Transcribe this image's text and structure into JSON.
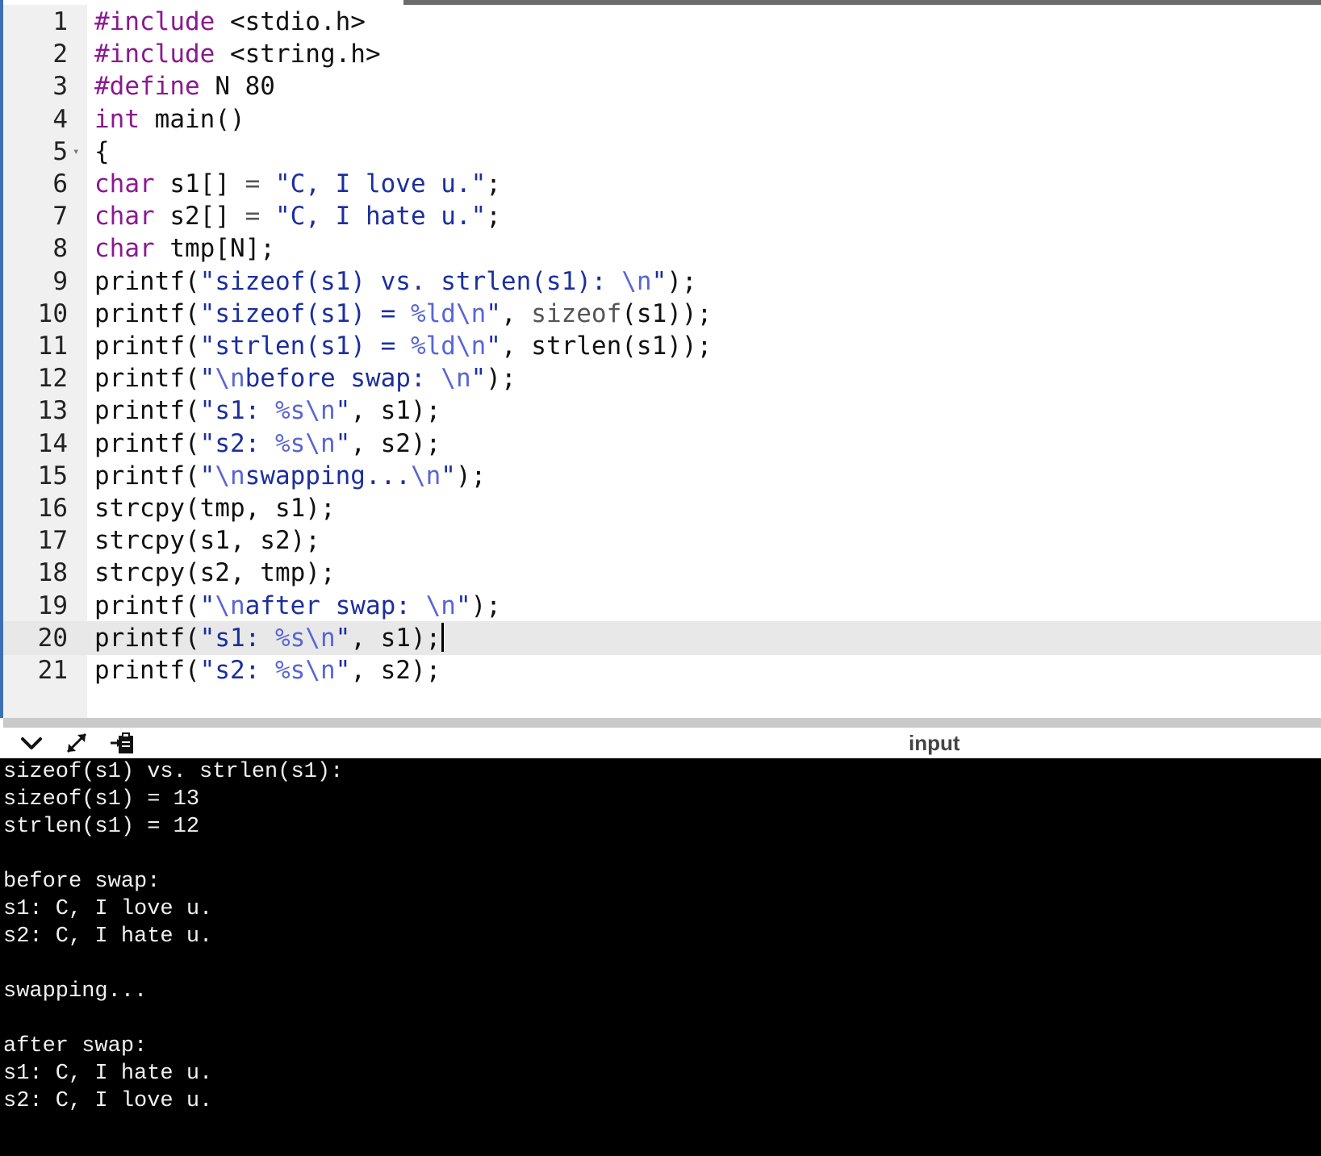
{
  "editor": {
    "active_line": 20,
    "lines": [
      {
        "n": "1",
        "tokens": [
          [
            "inc",
            "#include"
          ],
          [
            "",
            " <stdio.h>"
          ]
        ]
      },
      {
        "n": "2",
        "tokens": [
          [
            "inc",
            "#include"
          ],
          [
            "",
            " <string.h>"
          ]
        ]
      },
      {
        "n": "3",
        "tokens": [
          [
            "inc",
            "#define"
          ],
          [
            "",
            " N 80"
          ]
        ]
      },
      {
        "n": "4",
        "tokens": [
          [
            "kw",
            "int"
          ],
          [
            "",
            " main()"
          ]
        ]
      },
      {
        "n": "5",
        "fold": true,
        "tokens": [
          [
            "",
            "{"
          ]
        ]
      },
      {
        "n": "6",
        "tokens": [
          [
            "kw",
            "char"
          ],
          [
            "",
            " s1[] "
          ],
          [
            "op",
            "="
          ],
          [
            "",
            " "
          ],
          [
            "str",
            "\"C, I love u.\""
          ],
          [
            "",
            ";"
          ]
        ]
      },
      {
        "n": "7",
        "tokens": [
          [
            "kw",
            "char"
          ],
          [
            "",
            " s2[] "
          ],
          [
            "op",
            "="
          ],
          [
            "",
            " "
          ],
          [
            "str",
            "\"C, I hate u.\""
          ],
          [
            "",
            ";"
          ]
        ]
      },
      {
        "n": "8",
        "tokens": [
          [
            "kw",
            "char"
          ],
          [
            "",
            " tmp[N];"
          ]
        ]
      },
      {
        "n": "9",
        "tokens": [
          [
            "",
            "printf("
          ],
          [
            "str",
            "\"sizeof(s1) vs. strlen(s1): "
          ],
          [
            "esc",
            "\\n"
          ],
          [
            "str",
            "\""
          ],
          [
            "",
            ");"
          ]
        ]
      },
      {
        "n": "10",
        "tokens": [
          [
            "",
            "printf("
          ],
          [
            "str",
            "\"sizeof(s1) = "
          ],
          [
            "esc",
            "%ld\\n"
          ],
          [
            "str",
            "\""
          ],
          [
            "",
            ", "
          ],
          [
            "fn",
            "sizeof"
          ],
          [
            "",
            "(s1));"
          ]
        ]
      },
      {
        "n": "11",
        "tokens": [
          [
            "",
            "printf("
          ],
          [
            "str",
            "\"strlen(s1) = "
          ],
          [
            "esc",
            "%ld\\n"
          ],
          [
            "str",
            "\""
          ],
          [
            "",
            ", strlen(s1));"
          ]
        ]
      },
      {
        "n": "12",
        "tokens": [
          [
            "",
            "printf("
          ],
          [
            "str",
            "\""
          ],
          [
            "esc",
            "\\n"
          ],
          [
            "str",
            "before swap: "
          ],
          [
            "esc",
            "\\n"
          ],
          [
            "str",
            "\""
          ],
          [
            "",
            ");"
          ]
        ]
      },
      {
        "n": "13",
        "tokens": [
          [
            "",
            "printf("
          ],
          [
            "str",
            "\"s1: "
          ],
          [
            "esc",
            "%s\\n"
          ],
          [
            "str",
            "\""
          ],
          [
            "",
            ", s1);"
          ]
        ]
      },
      {
        "n": "14",
        "tokens": [
          [
            "",
            "printf("
          ],
          [
            "str",
            "\"s2: "
          ],
          [
            "esc",
            "%s\\n"
          ],
          [
            "str",
            "\""
          ],
          [
            "",
            ", s2);"
          ]
        ]
      },
      {
        "n": "15",
        "tokens": [
          [
            "",
            "printf("
          ],
          [
            "str",
            "\""
          ],
          [
            "esc",
            "\\n"
          ],
          [
            "str",
            "swapping..."
          ],
          [
            "esc",
            "\\n"
          ],
          [
            "str",
            "\""
          ],
          [
            "",
            ");"
          ]
        ]
      },
      {
        "n": "16",
        "tokens": [
          [
            "",
            "strcpy(tmp, s1);"
          ]
        ]
      },
      {
        "n": "17",
        "tokens": [
          [
            "",
            "strcpy(s1, s2);"
          ]
        ]
      },
      {
        "n": "18",
        "tokens": [
          [
            "",
            "strcpy(s2, tmp);"
          ]
        ]
      },
      {
        "n": "19",
        "tokens": [
          [
            "",
            "printf("
          ],
          [
            "str",
            "\""
          ],
          [
            "esc",
            "\\n"
          ],
          [
            "str",
            "after swap: "
          ],
          [
            "esc",
            "\\n"
          ],
          [
            "str",
            "\""
          ],
          [
            "",
            ");"
          ]
        ]
      },
      {
        "n": "20",
        "cursor": true,
        "tokens": [
          [
            "",
            "printf("
          ],
          [
            "str",
            "\"s1: "
          ],
          [
            "esc",
            "%s\\n"
          ],
          [
            "str",
            "\""
          ],
          [
            "",
            ", s1);"
          ]
        ]
      },
      {
        "n": "21",
        "tokens": [
          [
            "",
            "printf("
          ],
          [
            "str",
            "\"s2: "
          ],
          [
            "esc",
            "%s\\n"
          ],
          [
            "str",
            "\""
          ],
          [
            "",
            ", s2);"
          ]
        ]
      }
    ]
  },
  "toolbar": {
    "collapse_icon": "chevron-down-icon",
    "expand_icon": "expand-arrows-icon",
    "paste_icon": "clipboard-paste-icon",
    "input_label": "input"
  },
  "console": {
    "lines": [
      "sizeof(s1) vs. strlen(s1):",
      "sizeof(s1) = 13",
      "strlen(s1) = 12",
      "",
      "before swap:",
      "s1: C, I love u.",
      "s2: C, I hate u.",
      "",
      "swapping...",
      "",
      "after swap:",
      "s1: C, I hate u.",
      "s2: C, I love u."
    ]
  },
  "colors": {
    "preprocessor": "#8a1a8f",
    "keyword": "#8a1a8f",
    "string": "#1b2f9e",
    "escape": "#5866d6",
    "console_bg": "#000000",
    "console_fg": "#f0f0f0"
  }
}
